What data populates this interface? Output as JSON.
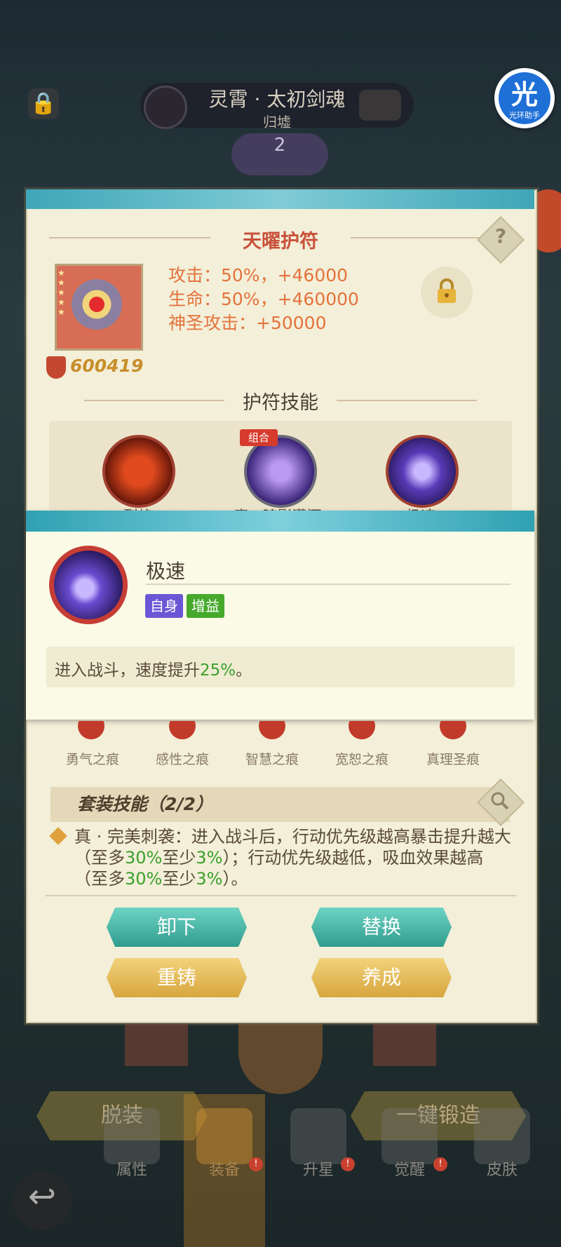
{
  "hero": {
    "name": "灵霄 · 太初剑魂",
    "subtitle": "归墟",
    "star_level": "2"
  },
  "helper_badge": {
    "char": "光",
    "label": "光环助手"
  },
  "amulet": {
    "title": "天曜护符",
    "stats": [
      "攻击：50%，+46000",
      "生命：50%，+460000",
      "神圣攻击：+50000"
    ],
    "power": "600419",
    "skills_title": "护符技能",
    "combo_tag": "组合",
    "skills": [
      "烈焰",
      "真 · 暗影潇洒",
      "极速"
    ]
  },
  "popup": {
    "skill_name": "极速",
    "tags": [
      "自身",
      "增益"
    ],
    "desc_prefix": "进入战斗，速度提升",
    "desc_value": "25%",
    "desc_suffix": "。"
  },
  "bag": [
    "勇气之痕",
    "感性之痕",
    "智慧之痕",
    "宽恕之痕",
    "真理圣痕"
  ],
  "set_skill": {
    "title": "套装技能（2/2）",
    "text_parts": [
      "真 · 完美刺袭：进入战斗后，行动优先级越高暴击提升越大（至多",
      "30%",
      "至少",
      "3%",
      "）；行动优先级越低，吸血效果越高（至多",
      "30%",
      "至少",
      "3%",
      "）。"
    ]
  },
  "actions": {
    "unequip": "卸下",
    "replace": "替换",
    "reforge": "重铸",
    "develop": "养成"
  },
  "bottom": {
    "strip": "脱装",
    "forge_all": "一键锻造"
  },
  "nav": [
    "属性",
    "装备",
    "升星",
    "觉醒",
    "皮肤"
  ],
  "colors": {
    "accent_teal": "#3fa6b7",
    "title_red": "#c9513a",
    "stat_orange": "#e4733c",
    "green": "#3ba02b",
    "gold": "#d8a63f"
  }
}
